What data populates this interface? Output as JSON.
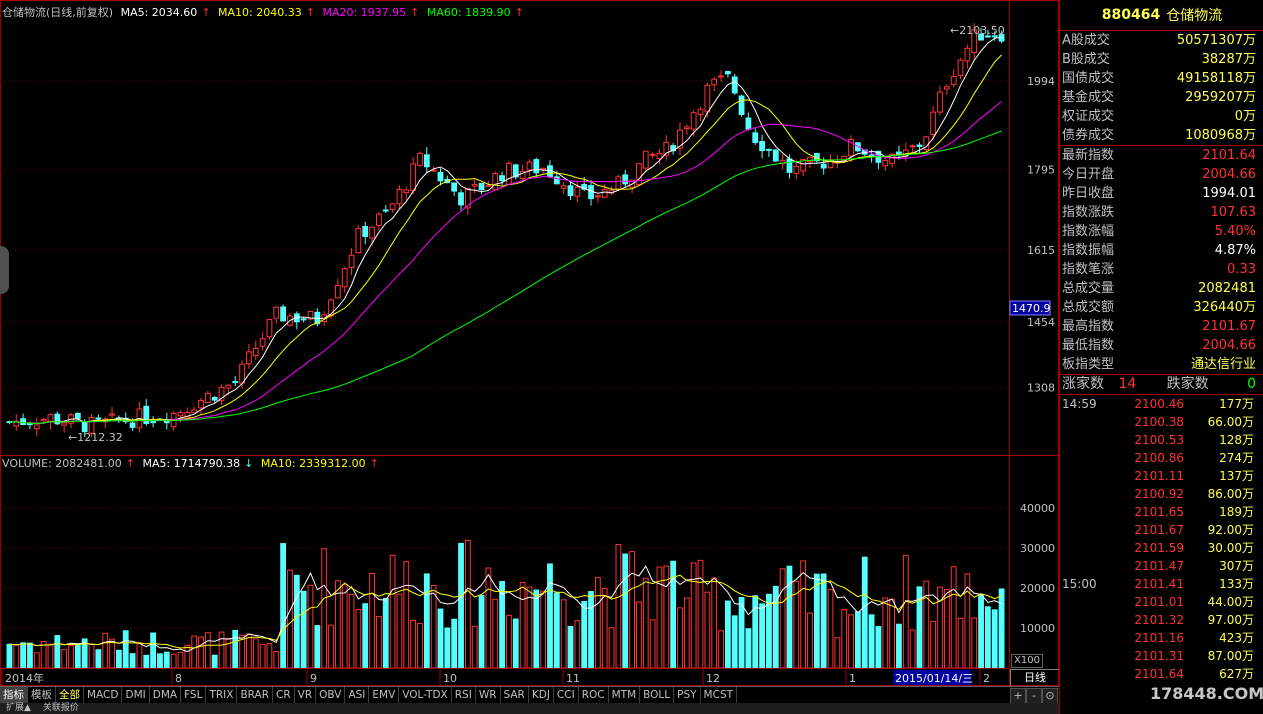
{
  "price_legend": {
    "title": "仓储物流(日线,前复权)",
    "ma5": "MA5: 2034.60",
    "ma10": "MA10: 2040.33",
    "ma20": "MA20: 1937.95",
    "ma60": "MA60: 1839.90"
  },
  "volume_legend": {
    "volume": "VOLUME: 2082481.00",
    "ma5": "MA5: 1714790.38",
    "ma10": "MA10: 2339312.00"
  },
  "colors": {
    "up": "#ff3232",
    "down": "#54ffff",
    "ma5": "#ffffff",
    "ma10": "#ffff00",
    "ma20": "#ff00ff",
    "ma60": "#00ff00"
  },
  "price_axis": {
    "ticks": [
      "1994",
      "1795",
      "1615",
      "1454",
      "1308"
    ],
    "cursor_value": "1470.9"
  },
  "volume_axis": {
    "ticks": [
      "40000",
      "30000",
      "20000",
      "10000"
    ],
    "unit_badge": "X100"
  },
  "x_axis": {
    "labels": [
      "2014年",
      "8",
      "9",
      "10",
      "11",
      "12",
      "1",
      "2"
    ],
    "selected_date": "2015/01/14/三"
  },
  "annotations": {
    "high_label": "2103.50",
    "low_label": "1212.32"
  },
  "period_label": "日线",
  "chart_data": {
    "type": "candlestick",
    "title": "仓储物流(日线,前复权)",
    "high": 2103.5,
    "low": 1212.32,
    "last_close": 2101.64,
    "volume_last": 2082481,
    "series": [
      {
        "name": "MA5",
        "last": 2034.6
      },
      {
        "name": "MA10",
        "last": 2040.33
      },
      {
        "name": "MA20",
        "last": 1937.95
      },
      {
        "name": "MA60",
        "last": 1839.9
      }
    ]
  },
  "quote_panel": {
    "code": "880464",
    "name": "仓储物流",
    "stats_group1": [
      {
        "label": "A股成交",
        "value": "50571307万",
        "color": "#ffff54"
      },
      {
        "label": "B股成交",
        "value": "38287万",
        "color": "#ffff54"
      },
      {
        "label": "国债成交",
        "value": "49158118万",
        "color": "#ffff54"
      },
      {
        "label": "基金成交",
        "value": "2959207万",
        "color": "#ffff54"
      },
      {
        "label": "权证成交",
        "value": "0万",
        "color": "#ffff54"
      },
      {
        "label": "债券成交",
        "value": "1080968万",
        "color": "#ffff54"
      }
    ],
    "stats_group2": [
      {
        "label": "最新指数",
        "value": "2101.64",
        "color": "#ff3232"
      },
      {
        "label": "今日开盘",
        "value": "2004.66",
        "color": "#ff3232"
      },
      {
        "label": "昨日收盘",
        "value": "1994.01",
        "color": "#ffffff"
      },
      {
        "label": "指数涨跌",
        "value": "107.63",
        "color": "#ff3232"
      },
      {
        "label": "指数涨幅",
        "value": "5.40%",
        "color": "#ff3232"
      },
      {
        "label": "指数振幅",
        "value": "4.87%",
        "color": "#ffffff"
      },
      {
        "label": "指数笔涨",
        "value": "0.33",
        "color": "#ff3232"
      },
      {
        "label": "总成交量",
        "value": "2082481",
        "color": "#ffff54"
      },
      {
        "label": "总成交额",
        "value": "326440万",
        "color": "#ffff54"
      },
      {
        "label": "最高指数",
        "value": "2101.67",
        "color": "#ff3232"
      },
      {
        "label": "最低指数",
        "value": "2004.66",
        "color": "#ff3232"
      },
      {
        "label": "板指类型",
        "value": "通达信行业",
        "color": "#ffff54"
      }
    ],
    "breadth": {
      "up_label": "涨家数",
      "up_value": "14",
      "down_label": "跌家数",
      "down_value": "0"
    },
    "ticks": [
      {
        "time": "14:59",
        "price": "2100.46",
        "vol": "177万"
      },
      {
        "time": "",
        "price": "2100.38",
        "vol": "66.00万"
      },
      {
        "time": "",
        "price": "2100.53",
        "vol": "128万"
      },
      {
        "time": "",
        "price": "2100.86",
        "vol": "274万"
      },
      {
        "time": "",
        "price": "2101.11",
        "vol": "137万"
      },
      {
        "time": "",
        "price": "2100.92",
        "vol": "86.00万"
      },
      {
        "time": "",
        "price": "2101.65",
        "vol": "189万"
      },
      {
        "time": "",
        "price": "2101.67",
        "vol": "92.00万"
      },
      {
        "time": "",
        "price": "2101.59",
        "vol": "30.00万"
      },
      {
        "time": "",
        "price": "2101.47",
        "vol": "307万"
      },
      {
        "time": "15:00",
        "price": "2101.41",
        "vol": "133万"
      },
      {
        "time": "",
        "price": "2101.01",
        "vol": "44.00万"
      },
      {
        "time": "",
        "price": "2101.32",
        "vol": "97.00万"
      },
      {
        "time": "",
        "price": "2101.16",
        "vol": "423万"
      },
      {
        "time": "",
        "price": "2101.31",
        "vol": "87.00万"
      },
      {
        "time": "",
        "price": "2101.64",
        "vol": "627万"
      }
    ]
  },
  "indicator_tabs": [
    "指标",
    "模板",
    "全部",
    "MACD",
    "DMI",
    "DMA",
    "FSL",
    "TRIX",
    "BRAR",
    "CR",
    "VR",
    "OBV",
    "ASI",
    "EMV",
    "VOL-TDX",
    "RSI",
    "WR",
    "SAR",
    "KDJ",
    "CCI",
    "ROC",
    "MTM",
    "BOLL",
    "PSY",
    "MCST"
  ],
  "bottom_tabs": [
    "扩展▲",
    "关联报价"
  ],
  "zoom_controls": [
    "+",
    "-",
    "⊙"
  ],
  "watermark": "178448.COM"
}
